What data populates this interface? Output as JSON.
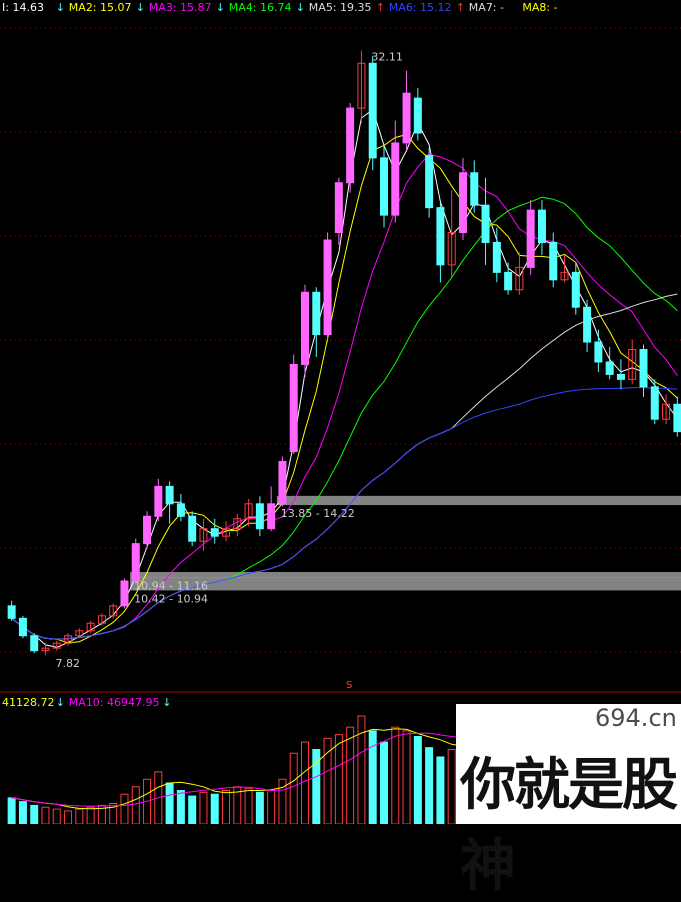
{
  "legend_top": [
    {
      "label": "I: 14.63",
      "arrow": "↓",
      "color": "#ffffff"
    },
    {
      "label": "MA2: 15.07",
      "arrow": "↓",
      "color": "#ffff00"
    },
    {
      "label": "MA3: 15.87",
      "arrow": "↓",
      "color": "#ff00ff"
    },
    {
      "label": "MA4: 16.74",
      "arrow": "↓",
      "color": "#00ff00"
    },
    {
      "label": "MA5: 19.35",
      "arrow": "↑",
      "color": "#dddddd"
    },
    {
      "label": "MA6: 15.12",
      "arrow": "↑",
      "color": "#3344ff"
    },
    {
      "label": "MA7: -",
      "arrow": "",
      "color": "#dddddd"
    },
    {
      "label": "MA8: -",
      "arrow": "",
      "color": "#ffff00"
    }
  ],
  "legend_volume": [
    {
      "label": "41128.72",
      "arrow": "↓",
      "color": "#ffff00"
    },
    {
      "label": "MA10: 46947.95",
      "arrow": "↓",
      "color": "#ff00ff"
    }
  ],
  "annotations": {
    "high": "32.11",
    "low": "7.82",
    "zone1": "13.85 - 14.22",
    "zone2": "10.94 - 11.16",
    "zone3": "10.42 - 10.94",
    "marker": "S"
  },
  "watermark": {
    "domain": "694.cn",
    "text": "你就是股神"
  },
  "colors": {
    "up": "#ff3b3b",
    "down": "#54ffff",
    "big_up": "#ff66ff",
    "big_down": "#00dd00",
    "ma1": "#ffffff",
    "ma2": "#ffff00",
    "ma3": "#ff00ff",
    "ma4": "#00ff00",
    "ma5": "#dddddd",
    "ma6": "#3344ff",
    "grid": "#aa0000",
    "zone": "#9a9a9a"
  },
  "chart_data": {
    "type": "candlestick",
    "price_range": [
      6.5,
      33.5
    ],
    "grid": true,
    "zones": [
      {
        "label_key": "zone1",
        "low": 13.85,
        "high": 14.22,
        "from_index": 24
      },
      {
        "label_key": "zone2",
        "low": 10.94,
        "high": 11.16,
        "from_index": 11
      },
      {
        "label_key": "zone3",
        "low": 10.42,
        "high": 10.94,
        "from_index": 11
      }
    ],
    "candles": [
      [
        9.8,
        9.3,
        10.0,
        9.2
      ],
      [
        9.3,
        8.6,
        9.4,
        8.5
      ],
      [
        8.6,
        8.0,
        8.7,
        7.9
      ],
      [
        8.0,
        8.1,
        8.3,
        7.82
      ],
      [
        8.1,
        8.3,
        8.4,
        8.0
      ],
      [
        8.3,
        8.6,
        8.7,
        8.2
      ],
      [
        8.6,
        8.8,
        8.9,
        8.5
      ],
      [
        8.8,
        9.1,
        9.2,
        8.7
      ],
      [
        9.1,
        9.4,
        9.5,
        9.0
      ],
      [
        9.4,
        9.8,
        9.9,
        9.3
      ],
      [
        9.8,
        10.8,
        10.9,
        9.7
      ],
      [
        10.8,
        12.3,
        12.5,
        10.7
      ],
      [
        12.3,
        13.4,
        13.6,
        12.1
      ],
      [
        13.4,
        14.6,
        14.9,
        13.2
      ],
      [
        14.6,
        13.9,
        14.8,
        13.1
      ],
      [
        13.9,
        13.4,
        14.3,
        13.2
      ],
      [
        13.4,
        12.4,
        13.6,
        12.2
      ],
      [
        12.4,
        12.9,
        13.3,
        12.0
      ],
      [
        12.9,
        12.6,
        13.3,
        12.3
      ],
      [
        12.6,
        12.9,
        13.2,
        12.4
      ],
      [
        12.9,
        13.3,
        13.5,
        12.6
      ],
      [
        13.3,
        13.9,
        14.1,
        13.0
      ],
      [
        13.9,
        12.9,
        14.2,
        12.6
      ],
      [
        12.9,
        13.9,
        14.6,
        12.8
      ],
      [
        13.9,
        15.6,
        15.8,
        13.8
      ],
      [
        16.0,
        19.5,
        19.9,
        15.9
      ],
      [
        19.5,
        22.4,
        22.7,
        19.0
      ],
      [
        22.4,
        20.7,
        22.6,
        19.8
      ],
      [
        20.7,
        24.5,
        24.8,
        20.4
      ],
      [
        24.8,
        26.8,
        27.0,
        24.3
      ],
      [
        26.8,
        29.8,
        30.0,
        26.4
      ],
      [
        29.8,
        31.6,
        32.11,
        29.2
      ],
      [
        31.6,
        27.8,
        31.9,
        27.3
      ],
      [
        27.8,
        25.5,
        28.3,
        25.0
      ],
      [
        25.5,
        28.4,
        29.3,
        25.2
      ],
      [
        28.4,
        30.4,
        31.3,
        28.1
      ],
      [
        30.2,
        28.8,
        30.6,
        28.5
      ],
      [
        27.9,
        25.8,
        28.2,
        25.4
      ],
      [
        25.8,
        23.5,
        26.0,
        22.8
      ],
      [
        23.5,
        24.8,
        26.5,
        23.0
      ],
      [
        24.8,
        27.2,
        27.8,
        24.5
      ],
      [
        27.2,
        25.9,
        27.7,
        25.6
      ],
      [
        25.9,
        24.4,
        27.0,
        23.5
      ],
      [
        24.4,
        23.2,
        25.0,
        22.8
      ],
      [
        23.2,
        22.5,
        23.6,
        22.3
      ],
      [
        22.5,
        23.4,
        24.0,
        22.3
      ],
      [
        23.4,
        25.7,
        26.1,
        23.1
      ],
      [
        25.7,
        24.4,
        26.1,
        23.9
      ],
      [
        24.4,
        22.9,
        24.8,
        22.6
      ],
      [
        22.9,
        23.2,
        23.9,
        22.8
      ],
      [
        23.2,
        21.8,
        23.6,
        21.5
      ],
      [
        21.8,
        20.4,
        22.1,
        20.0
      ],
      [
        20.4,
        19.6,
        20.9,
        19.2
      ],
      [
        19.6,
        19.1,
        20.2,
        18.9
      ],
      [
        19.1,
        18.9,
        19.7,
        18.5
      ],
      [
        18.9,
        20.1,
        20.5,
        18.7
      ],
      [
        20.1,
        18.6,
        20.3,
        18.2
      ],
      [
        18.6,
        17.3,
        18.9,
        17.1
      ],
      [
        17.3,
        17.9,
        18.3,
        17.1
      ],
      [
        17.9,
        16.8,
        18.2,
        16.6
      ]
    ],
    "volume": [
      14,
      12,
      10,
      9,
      8,
      7,
      8,
      9,
      10,
      11,
      16,
      20,
      24,
      28,
      22,
      18,
      15,
      17,
      16,
      18,
      20,
      19,
      17,
      18,
      24,
      38,
      44,
      40,
      46,
      48,
      52,
      58,
      50,
      44,
      52,
      50,
      47,
      41,
      36,
      40,
      45,
      42,
      38,
      34,
      32,
      36,
      40,
      37,
      33,
      31,
      29,
      27,
      25,
      24,
      22,
      26,
      24,
      22,
      21,
      20
    ]
  }
}
